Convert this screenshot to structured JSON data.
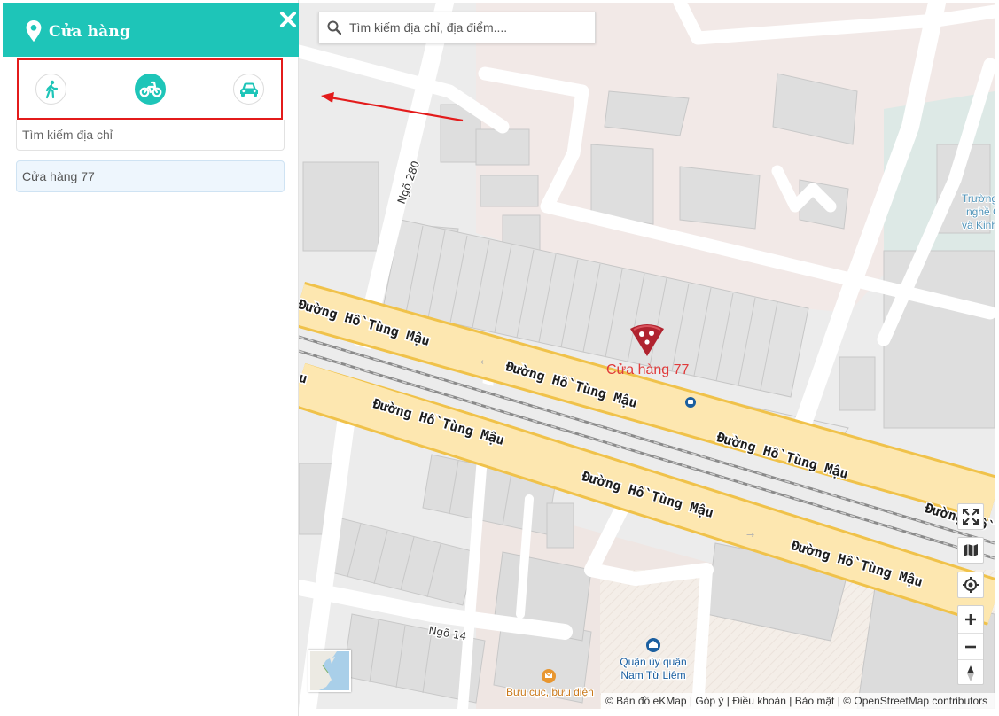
{
  "sidebar": {
    "title": "Cửa hàng",
    "travel_modes": [
      "walk",
      "motorbike",
      "car"
    ],
    "active_mode": "motorbike",
    "address_placeholder": "Tìm kiếm địa chỉ",
    "stores": [
      {
        "name": "Cửa hàng 77"
      }
    ]
  },
  "map": {
    "search_placeholder": "Tìm kiếm địa chỉ, địa điểm....",
    "marker_label": "Cửa hàng 77",
    "road_labels": {
      "main": "Đường Hồ Tùng Mậu",
      "main_partial_right": "Đường Hồ",
      "partial_left": "lu",
      "lane_280": "Ngõ 280",
      "lane_14": "Ngõ 14"
    },
    "pois": {
      "school_lines": [
        "Trường",
        "nghề C",
        "và Kinh"
      ],
      "party_committee_lines": [
        "Quận ủy quận",
        "Nam Từ Liêm"
      ],
      "post_office": "Bưu cục, bưu điện"
    },
    "attribution": {
      "prefix": "© Bản đồ eKMap",
      "links": [
        "Góp ý",
        "Điều khoản",
        "Bảo mật"
      ],
      "osm": "© OpenStreetMap contributors"
    }
  },
  "icons": {
    "header": "map-pin-icon",
    "close": "close-icon",
    "walk": "walk-icon",
    "motorbike": "motorbike-icon",
    "car": "car-icon",
    "search": "search-icon",
    "fullscreen": "fullscreen-icon",
    "layers": "map-layers-icon",
    "locate": "locate-icon",
    "zoom_in": "plus-icon",
    "zoom_out": "minus-icon",
    "north": "compass-north-icon"
  },
  "colors": {
    "accent": "#1ec5b8",
    "highlight_border": "#e31b1b",
    "marker": "#b0232f",
    "marker_label": "#e03a3a",
    "road_major": "#fde7b0",
    "road_major_border": "#f0c24a",
    "poi_blue": "#1b5fa0",
    "poi_orange": "#c9781a"
  }
}
